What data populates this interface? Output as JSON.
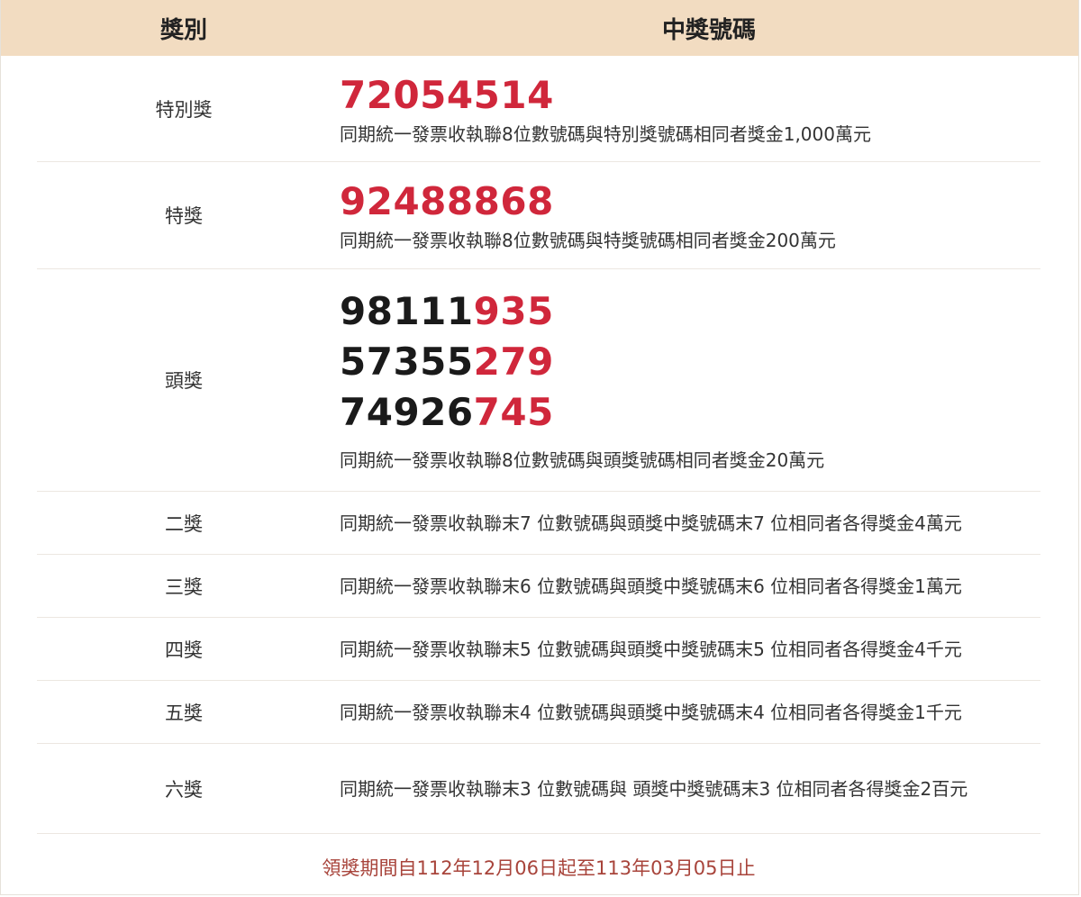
{
  "header": {
    "col_category": "獎別",
    "col_numbers": "中獎號碼"
  },
  "prizes": {
    "special": {
      "name": "特別獎",
      "number": "72054514",
      "desc": "同期統一發票收執聯8位數號碼與特別獎號碼相同者獎金1,000萬元"
    },
    "grand": {
      "name": "特獎",
      "number": "92488868",
      "desc": "同期統一發票收執聯8位數號碼與特獎號碼相同者獎金200萬元"
    },
    "first": {
      "name": "頭獎",
      "numbers": [
        {
          "prefix": "98111",
          "suffix": "935"
        },
        {
          "prefix": "57355",
          "suffix": "279"
        },
        {
          "prefix": "74926",
          "suffix": "745"
        }
      ],
      "desc": "同期統一發票收執聯8位數號碼與頭獎號碼相同者獎金20萬元"
    },
    "second": {
      "name": "二獎",
      "desc": "同期統一發票收執聯末7 位數號碼與頭獎中獎號碼末7 位相同者各得獎金4萬元"
    },
    "third": {
      "name": "三獎",
      "desc": "同期統一發票收執聯末6 位數號碼與頭獎中獎號碼末6 位相同者各得獎金1萬元"
    },
    "fourth": {
      "name": "四獎",
      "desc": "同期統一發票收執聯末5 位數號碼與頭獎中獎號碼末5 位相同者各得獎金4千元"
    },
    "fifth": {
      "name": "五獎",
      "desc": "同期統一發票收執聯末4 位數號碼與頭獎中獎號碼末4 位相同者各得獎金1千元"
    },
    "sixth": {
      "name": "六獎",
      "desc": "同期統一發票收執聯末3 位數號碼與 頭獎中獎號碼末3 位相同者各得獎金2百元"
    }
  },
  "footer": {
    "claim_period": "領獎期間自112年12月06日起至113年03月05日止"
  },
  "colors": {
    "header_bg": "#f2dcc1",
    "highlight_red": "#d0273b",
    "footer_text": "#a8443b"
  }
}
